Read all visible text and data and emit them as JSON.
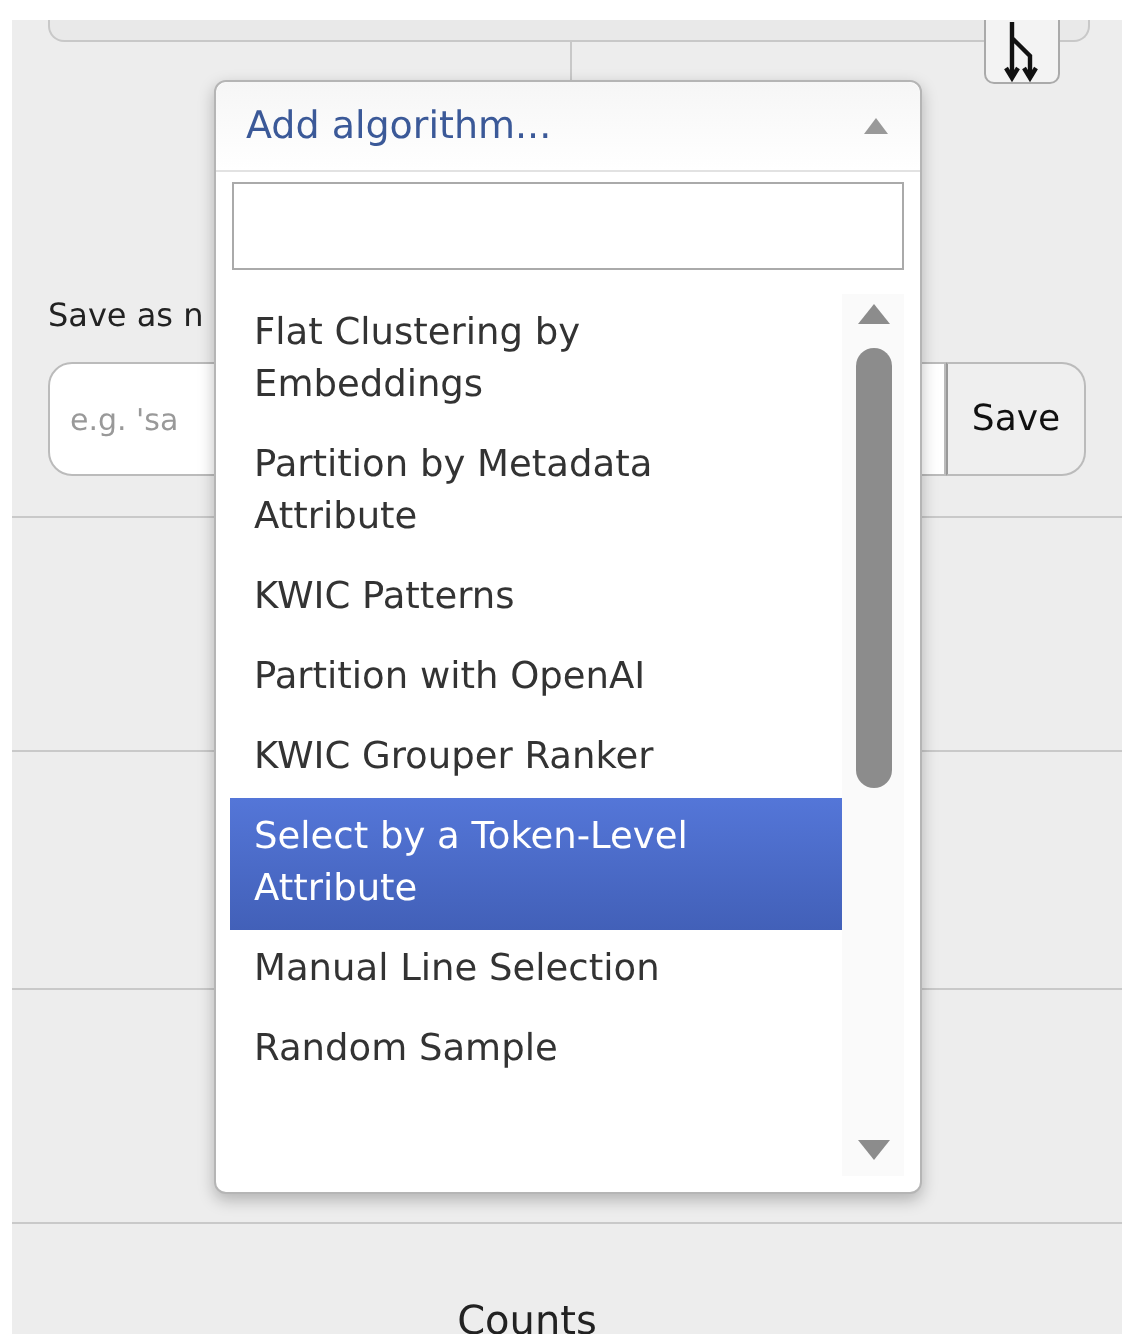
{
  "save": {
    "label": "Save as n",
    "placeholder": "e.g. 'sa",
    "button": "Save"
  },
  "dropdown": {
    "title": "Add algorithm...",
    "expanded": true,
    "items": [
      {
        "label": "Flat Clustering by Embeddings",
        "selected": false
      },
      {
        "label": "Partition by Metadata Attribute",
        "selected": false
      },
      {
        "label": "KWIC Patterns",
        "selected": false
      },
      {
        "label": "Partition with OpenAI",
        "selected": false
      },
      {
        "label": "KWIC Grouper Ranker",
        "selected": false
      },
      {
        "label": "Select by a Token-Level Attribute",
        "selected": true
      },
      {
        "label": "Manual Line Selection",
        "selected": false
      },
      {
        "label": "Random Sample",
        "selected": false
      }
    ]
  },
  "section_title": "Counts"
}
